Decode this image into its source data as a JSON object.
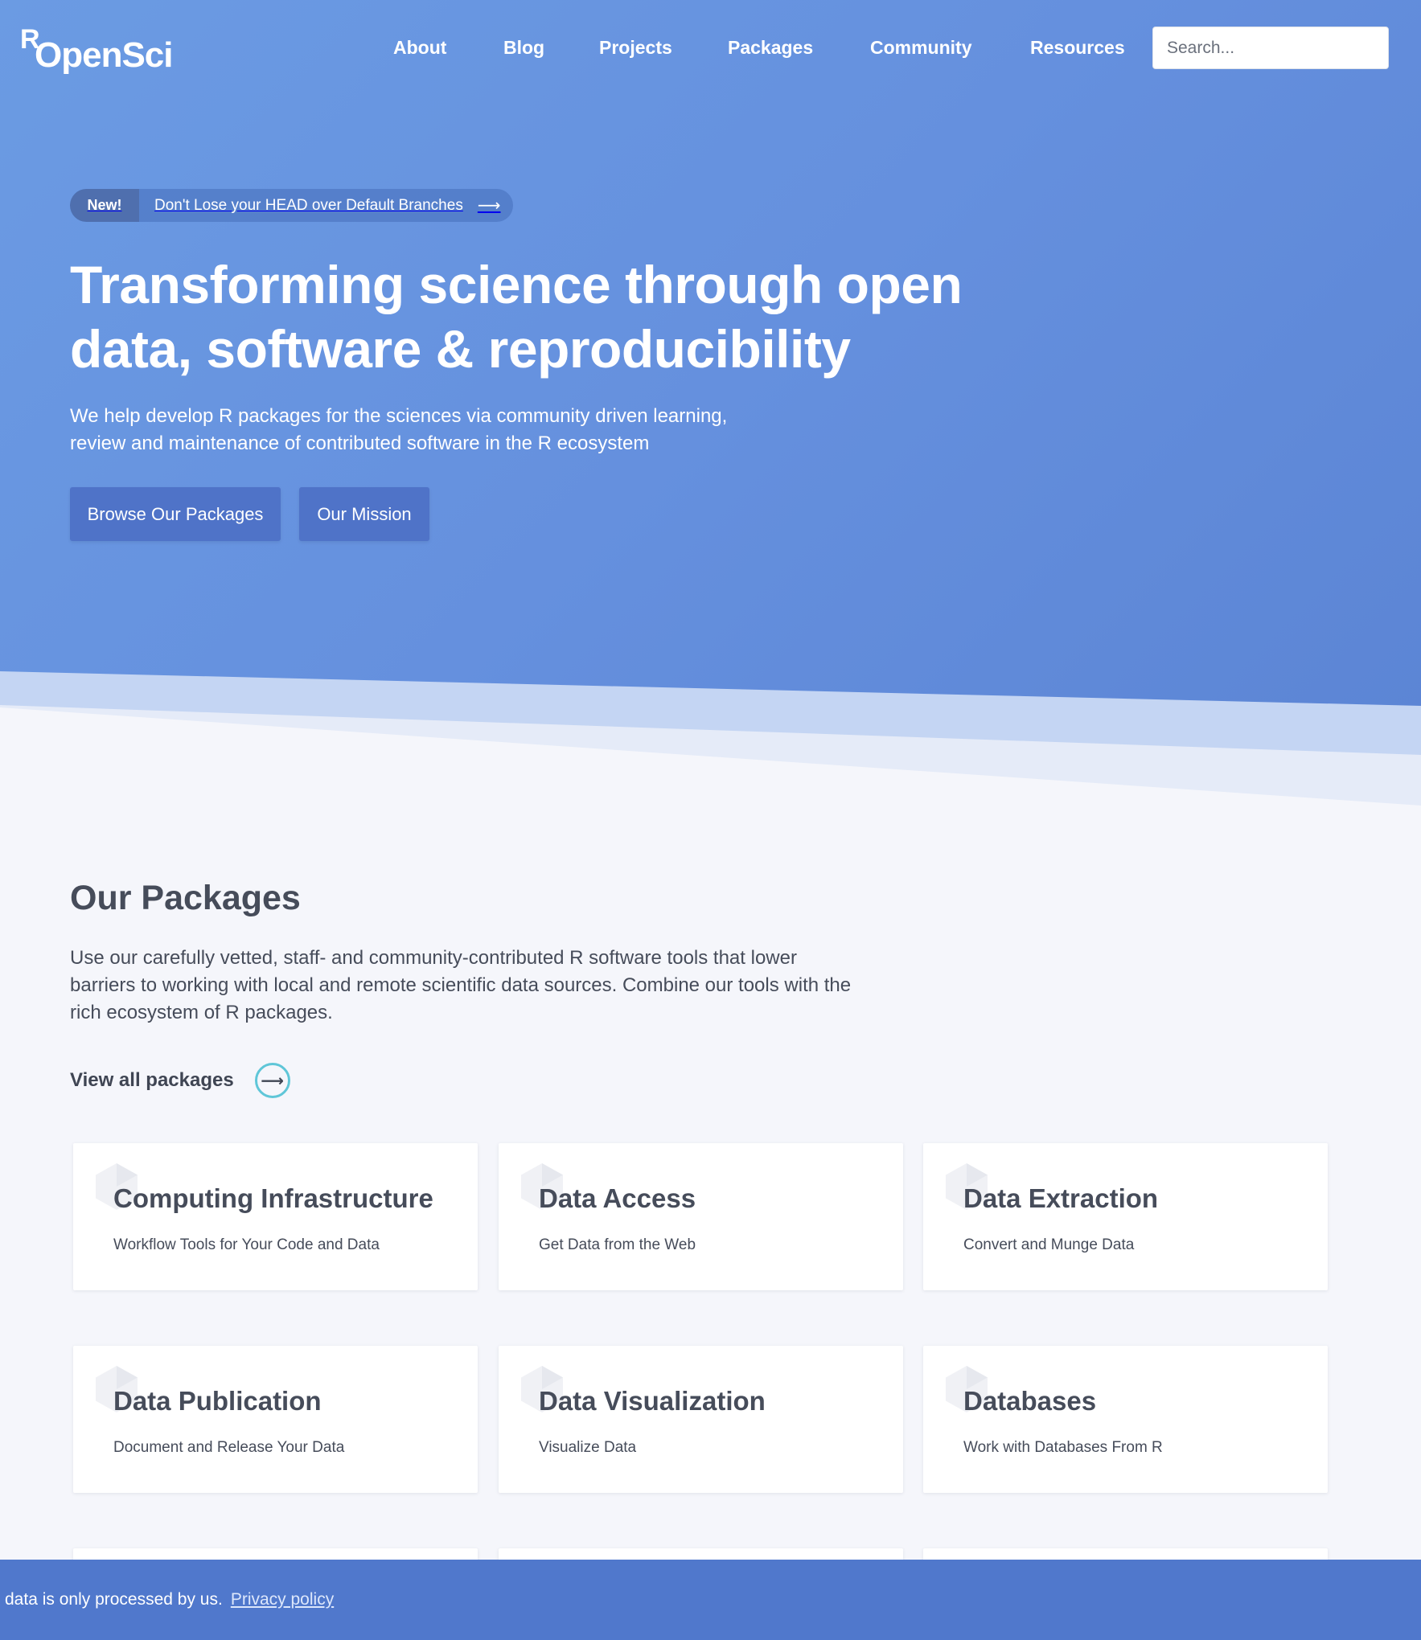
{
  "nav": {
    "logo_r": "R",
    "logo_text": "OpenSci",
    "links": [
      "About",
      "Blog",
      "Projects",
      "Packages",
      "Community",
      "Resources"
    ],
    "search_placeholder": "Search..."
  },
  "hero": {
    "announcement_badge": "New!",
    "announcement_text": "Don't Lose your HEAD over Default Branches",
    "announcement_arrow": "⟶",
    "title_line1": "Transforming science through open",
    "title_line2": "data, software & reproducibility",
    "subtitle_line1": "We help develop R packages for the sciences via community driven learning,",
    "subtitle_line2": "review and maintenance of contributed software in the R ecosystem",
    "primary_button": "Browse Our Packages",
    "secondary_button": "Our Mission"
  },
  "packages": {
    "title": "Our Packages",
    "description_line1": "Use our carefully vetted, staff- and community-contributed R software tools that lower",
    "description_line2": "barriers to working with local and remote scientific data sources. Combine our tools with the",
    "description_line3": "rich ecosystem of R packages.",
    "view_all": "View all packages",
    "view_all_arrow": "⟶",
    "cards": [
      {
        "title": "Computing Infrastructure",
        "desc": "Workflow Tools for Your Code and Data",
        "icon": "hexagon-icon"
      },
      {
        "title": "Data Access",
        "desc": "Get Data from the Web",
        "icon": "hexagon-icon"
      },
      {
        "title": "Data Extraction",
        "desc": "Convert and Munge Data",
        "icon": "hexagon-icon"
      },
      {
        "title": "Data Publication",
        "desc": "Document and Release Your Data",
        "icon": "hexagon-icon"
      },
      {
        "title": "Data Visualization",
        "desc": "Visualize Data",
        "icon": "hexagon-icon"
      },
      {
        "title": "Databases",
        "desc": "Work with Databases From R",
        "icon": "hexagon-icon"
      }
    ]
  },
  "cookie": {
    "text": "data is only processed by us.",
    "link": "Privacy policy"
  },
  "colors": {
    "hero_blue": "#6590de",
    "button_blue": "#4f73c8",
    "cookie_bar": "#5078cc",
    "accent_teal": "#5fc6d8",
    "text_dark": "#464c5a"
  }
}
